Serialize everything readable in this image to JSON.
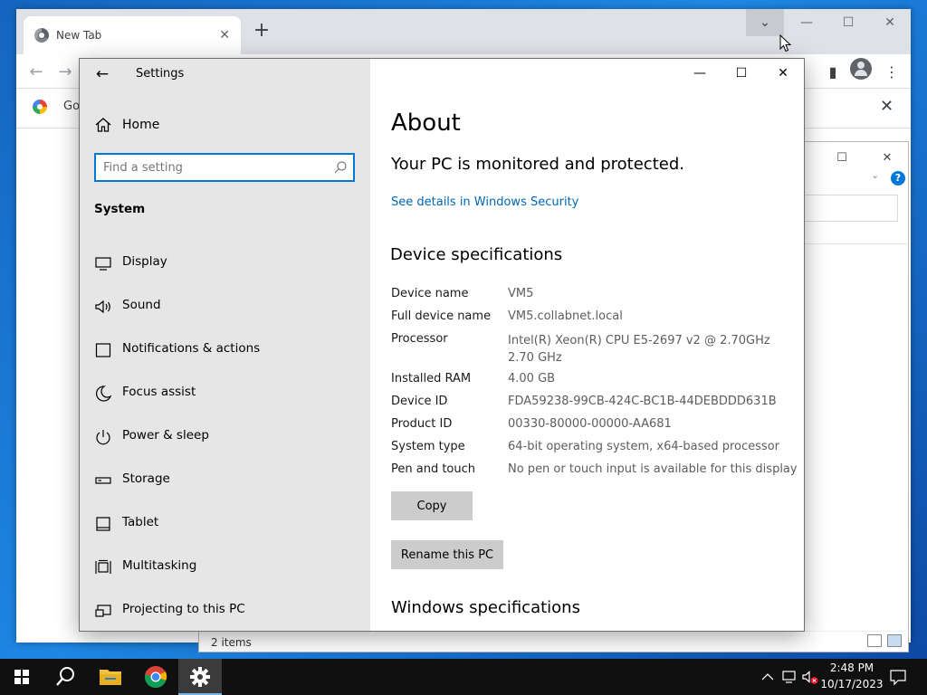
{
  "chrome": {
    "tab_title": "New Tab",
    "tab_close": "✕",
    "new_tab": "+",
    "bookmark_text": "Go",
    "bar_close": "✕",
    "tab_search": "⌄"
  },
  "explorer": {
    "status": "2 items",
    "help": "?"
  },
  "settings": {
    "app_title": "Settings",
    "home": "Home",
    "search_placeholder": "Find a setting",
    "section": "System",
    "nav": [
      {
        "label": "Display",
        "icon": "monitor-icon"
      },
      {
        "label": "Sound",
        "icon": "speaker-icon"
      },
      {
        "label": "Notifications & actions",
        "icon": "notification-icon"
      },
      {
        "label": "Focus assist",
        "icon": "moon-icon"
      },
      {
        "label": "Power & sleep",
        "icon": "power-icon"
      },
      {
        "label": "Storage",
        "icon": "storage-icon"
      },
      {
        "label": "Tablet",
        "icon": "tablet-icon"
      },
      {
        "label": "Multitasking",
        "icon": "multitasking-icon"
      },
      {
        "label": "Projecting to this PC",
        "icon": "projecting-icon"
      }
    ],
    "about": {
      "title": "About",
      "protection": "Your PC is monitored and protected.",
      "security_link": "See details in Windows Security",
      "spec_heading": "Device specifications",
      "specs": [
        {
          "label": "Device name",
          "value": "VM5"
        },
        {
          "label": "Full device name",
          "value": "VM5.collabnet.local"
        },
        {
          "label": "Processor",
          "value": "Intel(R) Xeon(R) CPU E5-2697 v2 @ 2.70GHz 2.70 GHz"
        },
        {
          "label": "Installed RAM",
          "value": "4.00 GB"
        },
        {
          "label": "Device ID",
          "value": "FDA59238-99CB-424C-BC1B-44DEBDDD631B"
        },
        {
          "label": "Product ID",
          "value": "00330-80000-00000-AA681"
        },
        {
          "label": "System type",
          "value": "64-bit operating system, x64-based processor"
        },
        {
          "label": "Pen and touch",
          "value": "No pen or touch input is available for this display"
        }
      ],
      "copy_button": "Copy",
      "rename_button": "Rename this PC",
      "windows_heading": "Windows specifications"
    }
  },
  "taskbar": {
    "time": "2:48 PM",
    "date": "10/17/2023"
  }
}
